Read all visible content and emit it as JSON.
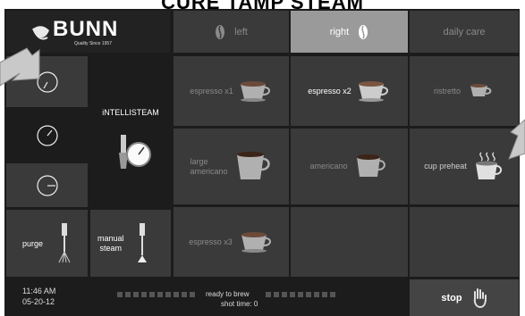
{
  "caption": "CURE TAMP STEAM",
  "brand": {
    "name": "BUNN",
    "tagline": "Quality Since 1957"
  },
  "tabs": [
    {
      "label": "left",
      "state": "inactive"
    },
    {
      "label": "right",
      "state": "active"
    },
    {
      "label": "daily care",
      "state": "inactive"
    }
  ],
  "steam": {
    "label": "iNTELLISTEAM"
  },
  "left_buttons": {
    "purge": "purge",
    "manual_steam": "manual\nsteam"
  },
  "drinks": [
    {
      "label": "espresso x1",
      "state": "dim"
    },
    {
      "label": "espresso x2",
      "state": "lit"
    },
    {
      "label": "ristretto",
      "state": "dim"
    },
    {
      "label": "large\namericano",
      "state": "dim"
    },
    {
      "label": "americano",
      "state": "dim"
    },
    {
      "label": "cup preheat",
      "state": "normal"
    },
    {
      "label": "espresso x3",
      "state": "dim"
    }
  ],
  "status": {
    "time": "11:46 AM",
    "date": "05-20-12",
    "message": "ready to brew",
    "shot_time": "shot time: 0"
  },
  "stop_label": "stop",
  "colors": {
    "tile": "#3a3a3a",
    "background": "#1c1c1c",
    "tab_active": "#9a9a9a",
    "arrow": "#bdbdbd"
  }
}
